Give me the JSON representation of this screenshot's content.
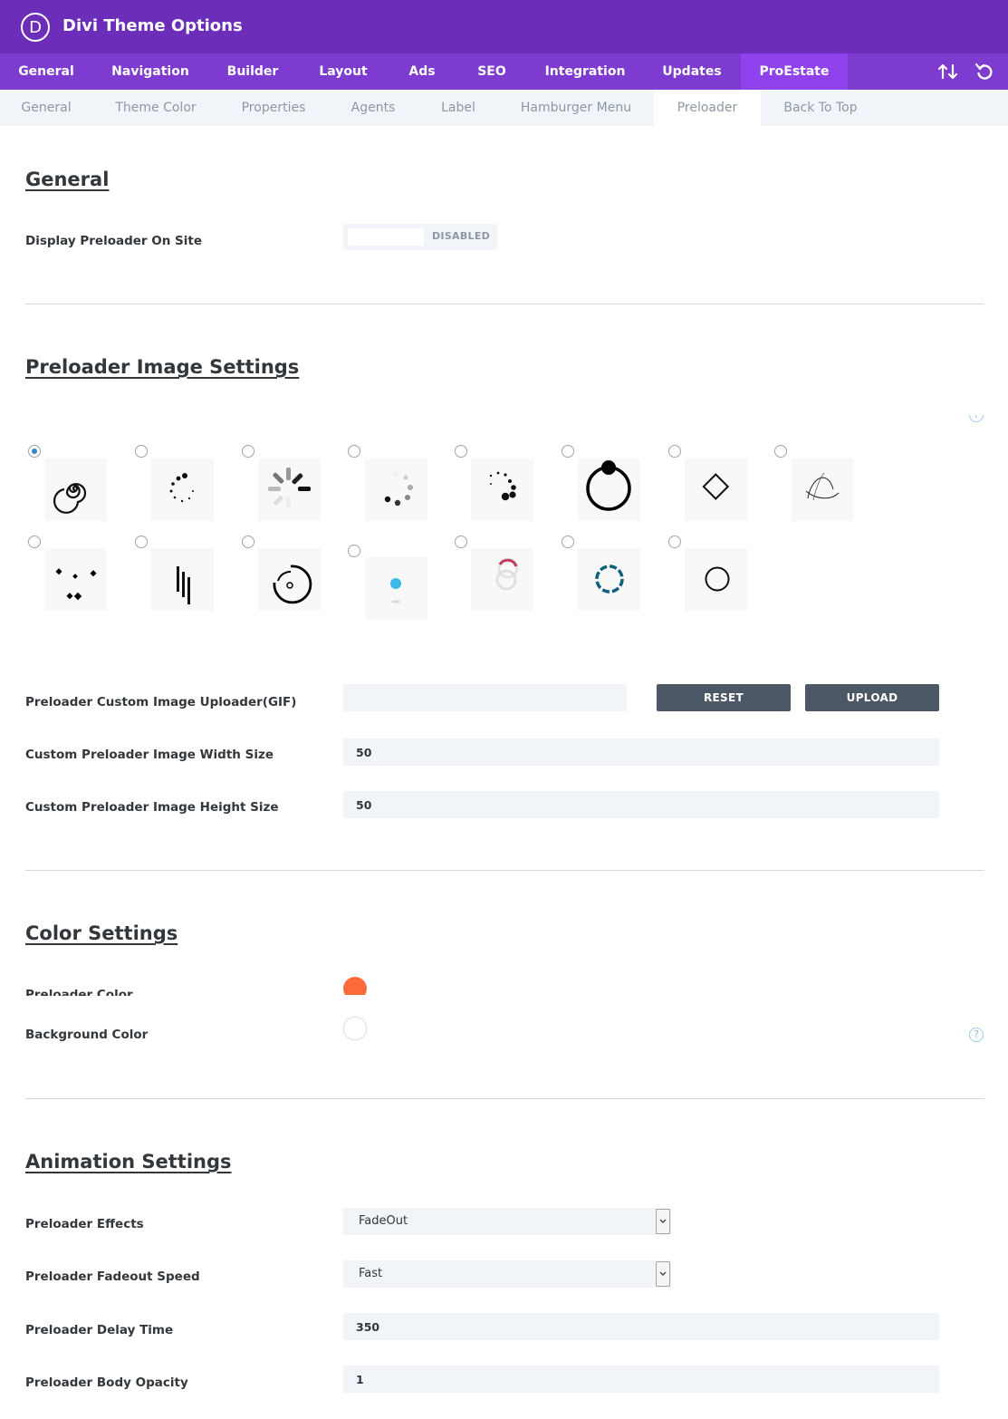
{
  "header": {
    "logo_letter": "D",
    "title": "Divi Theme Options"
  },
  "main_tabs": [
    {
      "label": "General"
    },
    {
      "label": "Navigation"
    },
    {
      "label": "Builder"
    },
    {
      "label": "Layout"
    },
    {
      "label": "Ads"
    },
    {
      "label": "SEO"
    },
    {
      "label": "Integration"
    },
    {
      "label": "Updates"
    },
    {
      "label": "ProEstate",
      "active": true
    }
  ],
  "header_icons": [
    "sort-arrows-icon",
    "undo-icon"
  ],
  "sub_tabs": [
    {
      "label": "General"
    },
    {
      "label": "Theme Color"
    },
    {
      "label": "Properties"
    },
    {
      "label": "Agents"
    },
    {
      "label": "Label"
    },
    {
      "label": "Hamburger Menu"
    },
    {
      "label": "Preloader",
      "active": true
    },
    {
      "label": "Back To Top"
    }
  ],
  "general": {
    "title": "General",
    "display_label": "Display Preloader On Site",
    "toggle_state": "DISABLED"
  },
  "image_settings": {
    "title": "Preloader Image Settings",
    "selected_index": 0,
    "preloader_styles": [
      "spiral-icon",
      "dots-circle-icon",
      "spinner-bars-icon",
      "fading-dots-icon",
      "growing-dots-icon",
      "ring-ball-icon",
      "diamond-icon",
      "orbit-lines-icon",
      "scattered-dots-icon",
      "vertical-lines-icon",
      "arc-spinner-icon",
      "bouncing-ball-icon",
      "linked-rings-icon",
      "dashed-ring-icon",
      "thin-ring-icon"
    ],
    "uploader_label": "Preloader Custom Image Uploader(GIF)",
    "uploader_value": "",
    "reset_label": "RESET",
    "upload_label": "UPLOAD",
    "width_label": "Custom Preloader Image Width Size",
    "width_value": "50",
    "height_label": "Custom Preloader Image Height Size",
    "height_value": "50"
  },
  "color_settings": {
    "title": "Color Settings",
    "preloader_color_label": "Preloader Color",
    "preloader_color": "#fd6b3a",
    "background_color_label": "Background Color",
    "background_color": "#ffffff"
  },
  "animation_settings": {
    "title": "Animation Settings",
    "effects_label": "Preloader Effects",
    "effects_value": "FadeOut",
    "fadeout_label": "Preloader Fadeout Speed",
    "fadeout_value": "Fast",
    "delay_label": "Preloader Delay Time",
    "delay_value": "350",
    "opacity_label": "Preloader Body Opacity",
    "opacity_value": "1"
  },
  "help_symbol": "?",
  "colors": {
    "header": "#6c2eb9",
    "main_nav": "#7e3bd0",
    "active_tab": "#8f42ec",
    "button": "#4c5866",
    "radio_checked": "#2e89c7"
  }
}
